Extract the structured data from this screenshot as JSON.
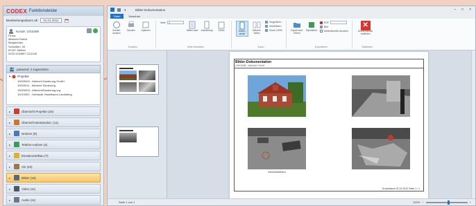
{
  "left": {
    "logo_text": "CODEX",
    "app_title": "Funktionsleiste",
    "date_label": "Bearbeitungsdatum ab",
    "date_value": "01.01.2012",
    "user": {
      "header": "Kunde: 1015288",
      "lines": [
        "Firma",
        "Albrecht GmbH",
        "Bergkirchen",
        "Schichten, 20",
        "87437 Stetten",
        "0221/1234567-11/1240"
      ]
    },
    "projects_button": "passend: 4 zugeordnet",
    "tree": {
      "root": "Projekte",
      "children": [
        "10020002 - Albrecht Sanierung GmbH",
        "10020011 - Albrecht Sanierung",
        "10020003 - Albrecht/Sanierung.org",
        "11010002 - Gebäude Haselbaum Landsberg"
      ]
    },
    "nav": [
      {
        "label": "Übersicht Projekte  (20)",
        "active": false,
        "icon_color": "#d23c2a"
      },
      {
        "label": "Übersicht Bestandsnr.  (11)",
        "active": false,
        "icon_color": "#c77a2a"
      },
      {
        "label": "Notizen  (8)",
        "active": false,
        "icon_color": "#4a78b8"
      },
      {
        "label": "Telefon-notizen  (4)",
        "active": false,
        "icon_color": "#3c9a5a"
      },
      {
        "label": "Einsatzorte/Bau  (7)",
        "active": false,
        "icon_color": "#e0b030"
      },
      {
        "label": "CE (22)",
        "active": false,
        "icon_color": "#9a7a4a"
      },
      {
        "label": "Bilder  (18)",
        "active": true,
        "icon_color": "#5a6a7a"
      },
      {
        "label": "Video  (11)",
        "active": false,
        "icon_color": "#4a5a6a"
      },
      {
        "label": "Audio  (11)",
        "active": false,
        "icon_color": "#6a7a8a"
      }
    ]
  },
  "main": {
    "window_title": "Bilder-Dokumentation",
    "window_controls": [
      "–",
      "□",
      "×"
    ],
    "tabs": [
      {
        "label": "Datei",
        "active": true
      },
      {
        "label": "Vorschau",
        "active": false
      }
    ],
    "ribbon": {
      "group_print": {
        "label": "Drucken",
        "buttons": [
          "Schnell-drucken",
          "Drucken",
          "Optionen"
        ]
      },
      "group_page": {
        "label": "Seite einrichten",
        "field_label": "Seite",
        "field_value": "1",
        "buttons": [
          "Seiten-rand",
          "Ausrichtung",
          "Größe"
        ]
      },
      "group_view": {
        "label": "Zoom",
        "buttons": [
          "Seiten-weise",
          "Mehrere Seiten"
        ],
        "small": [
          "Vergrößern",
          "Verkleinern",
          "Zoom 100%"
        ]
      },
      "group_export": {
        "label": "Exportieren",
        "buttons": [
          "Export nach Ordner",
          "Exportieren"
        ],
        "small": [
          "PDF",
          "Bild",
          "Excel"
        ],
        "checkbox": "Seitenbereich drucken"
      },
      "group_close": {
        "label": "Schließen",
        "button": "Druckvorschau schließen"
      }
    },
    "page": {
      "title": "Bilder-Dokumentation",
      "subtitle": "10015288 · Albrecht GmbH",
      "caption": "Schneefall/Dach",
      "footer": "Druckdatum 01.01.2012  Seite 1 / 1"
    },
    "status": {
      "page": "Seite 1 von 1",
      "zoom": "100%",
      "zoom_level": 0.55
    }
  }
}
